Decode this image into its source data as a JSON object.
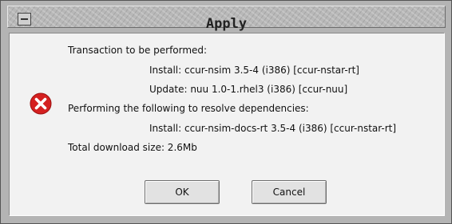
{
  "window": {
    "title": "Apply"
  },
  "message": {
    "heading": "Transaction to be performed:",
    "install_line": "Install: ccur-nsim 3.5-4 (i386) [ccur-nstar-rt]",
    "update_line": "Update: nuu 1.0-1.rhel3 (i386) [ccur-nuu]",
    "deps_heading": "Performing the following to resolve dependencies:",
    "deps_install_line": "Install: ccur-nsim-docs-rt 3.5-4 (i386) [ccur-nstar-rt]",
    "download_size": "Total download size: 2.6Mb"
  },
  "buttons": {
    "ok_label": "OK",
    "cancel_label": "Cancel"
  },
  "icons": {
    "status": "error-icon",
    "window_menu": "window-menu-icon"
  },
  "colors": {
    "error_red": "#d42020",
    "panel_bg": "#f2f2f2",
    "frame_bg": "#b4b4b4"
  }
}
